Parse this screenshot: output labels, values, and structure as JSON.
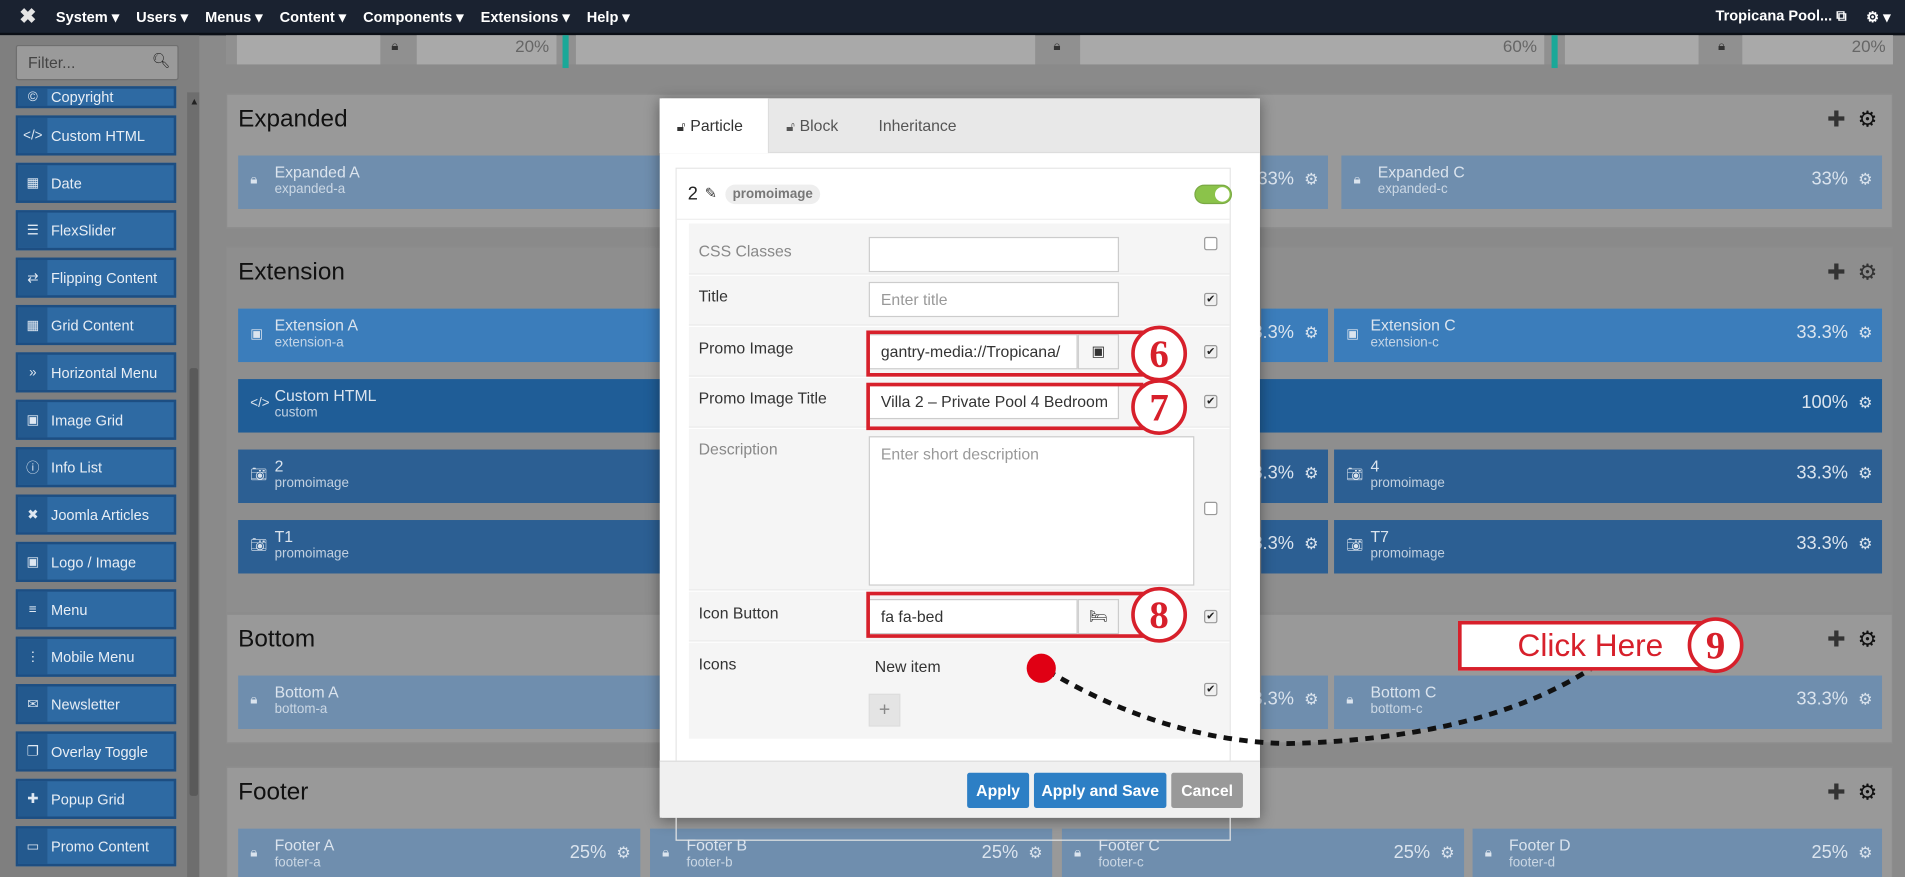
{
  "topbar": {
    "logo": "✖",
    "menus": [
      "System",
      "Users",
      "Menus",
      "Content",
      "Components",
      "Extensions",
      "Help"
    ],
    "site_name": "Tropicana Pool...",
    "gear": "⚙"
  },
  "sidebar": {
    "filter_placeholder": "Filter...",
    "items": [
      {
        "label": "Copyright",
        "icon": "copyright-icon",
        "glyph": "©"
      },
      {
        "label": "Custom HTML",
        "icon": "code-icon",
        "glyph": "</>"
      },
      {
        "label": "Date",
        "icon": "calendar-icon",
        "glyph": "▦"
      },
      {
        "label": "FlexSlider",
        "icon": "sliders-icon",
        "glyph": "☰"
      },
      {
        "label": "Flipping Content",
        "icon": "exchange-icon",
        "glyph": "⇄"
      },
      {
        "label": "Grid Content",
        "icon": "grid-icon",
        "glyph": "▦"
      },
      {
        "label": "Horizontal Menu",
        "icon": "forward-icon",
        "glyph": "»"
      },
      {
        "label": "Image Grid",
        "icon": "image-icon",
        "glyph": "▣"
      },
      {
        "label": "Info List",
        "icon": "info-icon",
        "glyph": "ⓘ"
      },
      {
        "label": "Joomla Articles",
        "icon": "joomla-icon",
        "glyph": "✖"
      },
      {
        "label": "Logo / Image",
        "icon": "picture-icon",
        "glyph": "▣"
      },
      {
        "label": "Menu",
        "icon": "menu-icon",
        "glyph": "≡"
      },
      {
        "label": "Mobile Menu",
        "icon": "ellipsis-icon",
        "glyph": "⋮"
      },
      {
        "label": "Newsletter",
        "icon": "envelope-icon",
        "glyph": "✉"
      },
      {
        "label": "Overlay Toggle",
        "icon": "clone-icon",
        "glyph": "❐"
      },
      {
        "label": "Popup Grid",
        "icon": "expand-icon",
        "glyph": "✚"
      },
      {
        "label": "Promo Content",
        "icon": "desktop-icon",
        "glyph": "▭"
      }
    ]
  },
  "top_strip": {
    "pct_a": "20%",
    "pct_b": "60%",
    "pct_c": "20%"
  },
  "sections": {
    "expanded": {
      "title": "Expanded",
      "blocks": [
        {
          "name": "Expanded A",
          "sub": "expanded-a"
        },
        {
          "pct": "33%"
        },
        {
          "name": "Expanded C",
          "sub": "expanded-c",
          "pct": "33%"
        }
      ]
    },
    "extension": {
      "title": "Extension",
      "rows": [
        {
          "left": {
            "name": "Extension A",
            "sub": "extension-a"
          },
          "mid_pct": "33.3%",
          "right": {
            "name": "Extension C",
            "sub": "extension-c",
            "pct": "33.3%"
          }
        },
        {
          "left": {
            "name": "Custom HTML",
            "sub": "custom"
          },
          "right_pct": "100%"
        },
        {
          "left": {
            "name": "2",
            "sub": "promoimage"
          },
          "mid_pct": "33.3%",
          "right": {
            "name": "4",
            "sub": "promoimage",
            "pct": "33.3%"
          }
        },
        {
          "left": {
            "name": "T1",
            "sub": "promoimage"
          },
          "mid_pct": "33.3%",
          "right": {
            "name": "T7",
            "sub": "promoimage",
            "pct": "33.3%"
          }
        }
      ]
    },
    "bottom": {
      "title": "Bottom",
      "blocks": [
        {
          "name": "Bottom A",
          "sub": "bottom-a"
        },
        {
          "pct": "33.3%"
        },
        {
          "name": "Bottom C",
          "sub": "bottom-c",
          "pct": "33.3%"
        }
      ]
    },
    "footer": {
      "title": "Footer",
      "blocks": [
        {
          "name": "Footer A",
          "sub": "footer-a",
          "pct": "25%"
        },
        {
          "name": "Footer B",
          "sub": "footer-b",
          "pct": "25%"
        },
        {
          "name": "Footer C",
          "sub": "footer-c",
          "pct": "25%"
        },
        {
          "name": "Footer D",
          "sub": "footer-d",
          "pct": "25%"
        }
      ]
    }
  },
  "modal": {
    "tabs": [
      "Particle",
      "Block",
      "Inheritance"
    ],
    "particle_number": "2",
    "particle_type": "promoimage",
    "enabled": true,
    "fields": {
      "css_classes": {
        "label": "CSS Classes",
        "value": ""
      },
      "title": {
        "label": "Title",
        "placeholder": "Enter title"
      },
      "promo_image": {
        "label": "Promo Image",
        "value": "gantry-media://Tropicana/"
      },
      "promo_image_title": {
        "label": "Promo Image Title",
        "value": "Villa 2 – Private Pool 4 Bedroom"
      },
      "description": {
        "label": "Description",
        "placeholder": "Enter short description"
      },
      "icon_button": {
        "label": "Icon Button",
        "value": "fa fa-bed"
      },
      "icons": {
        "label": "Icons",
        "item": "New item"
      }
    },
    "buttons": {
      "apply": "Apply",
      "apply_save": "Apply and Save",
      "cancel": "Cancel"
    }
  },
  "annotations": {
    "step6": "6",
    "step7": "7",
    "step8": "8",
    "step9": "9",
    "click_here": "Click Here",
    "accent_color": "#d7202b"
  }
}
